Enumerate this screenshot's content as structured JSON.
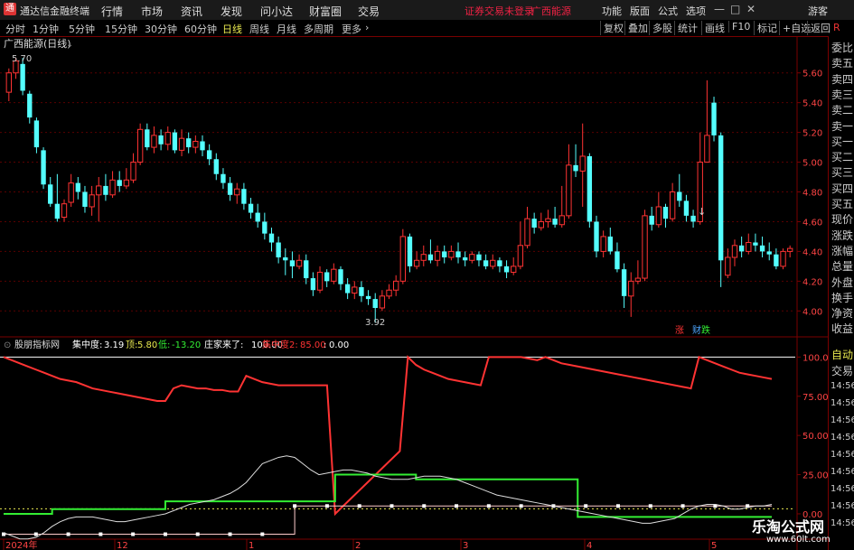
{
  "menubar": {
    "logo": "通",
    "app_title": "通达信金融终端",
    "items": [
      "行情",
      "市场",
      "资讯",
      "发现",
      "问小达",
      "财富圈",
      "交易"
    ],
    "notice": "证券交易未登录",
    "stock_name": "广西能源",
    "right_items": [
      "功能",
      "版面",
      "公式",
      "选项"
    ],
    "guest": "游客"
  },
  "toolbar": {
    "periods": [
      "分时",
      "1分钟",
      "5分钟",
      "15分钟",
      "30分钟",
      "60分钟",
      "日线",
      "周线",
      "月线",
      "多周期",
      "更多"
    ],
    "selected": "日线",
    "right_buttons": [
      "复权",
      "叠加",
      "多股",
      "统计",
      "画线",
      "F10",
      "标记",
      "+自选",
      "返回"
    ]
  },
  "main_chart": {
    "title": "广西能源(日线)",
    "high_label": "5.70",
    "low_label": "3.92",
    "zhang_label": "涨",
    "cai_label": "财",
    "die_label": "跌",
    "arrow_mark": "↓"
  },
  "indicator": {
    "name": "股朋指标网",
    "line1_label": "集中度:",
    "line1_value": "3.19",
    "line2_label": "顶:",
    "line2_value": "5.80",
    "line3_label": "低:",
    "line3_value": "-13.20",
    "line4_label": "庄家来了:",
    "line4_value": "100.00",
    "line5_label": "集中度2:",
    "line5_value": "85.00",
    "line6_label": ":",
    "line6_value": "0.00"
  },
  "right_panel": {
    "labels": [
      "委比",
      "卖五",
      "卖四",
      "卖三",
      "卖二",
      "卖一",
      "买一",
      "买二",
      "买三",
      "买四",
      "买五",
      "现价",
      "涨跌",
      "涨幅",
      "总量",
      "外盘",
      "换手",
      "净资",
      "收益"
    ],
    "bottom_labels": [
      "自动",
      "交易"
    ],
    "times": [
      "14:56",
      "14:56",
      "14:56",
      "14:56",
      "14:56",
      "14:56",
      "14:56",
      "14:56",
      "14:56"
    ]
  },
  "x_axis": {
    "labels": [
      "2024年",
      "12",
      "1",
      "2",
      "3",
      "4",
      "5"
    ]
  },
  "watermark": {
    "line1": "乐淘公式网",
    "line2": "www.60lt.com"
  },
  "chart_data": [
    {
      "type": "candlestick",
      "ylim": [
        3.85,
        5.75
      ],
      "yticks": [
        4.0,
        4.2,
        4.4,
        4.6,
        4.8,
        5.0,
        5.2,
        5.4,
        5.6
      ],
      "ytick_labels": [
        "4.00",
        "4.20",
        "4.40",
        "4.60",
        "4.80",
        "5.00",
        "5.20",
        "5.40",
        "5.60"
      ],
      "colors": {
        "up": "#ff3333",
        "down": "#54ffff"
      },
      "candles": [
        [
          5.47,
          5.6,
          5.63,
          5.41
        ],
        [
          5.6,
          5.68,
          5.7,
          5.56
        ],
        [
          5.66,
          5.48,
          5.7,
          5.45
        ],
        [
          5.46,
          5.3,
          5.48,
          5.26
        ],
        [
          5.28,
          5.1,
          5.3,
          5.06
        ],
        [
          5.08,
          4.85,
          5.1,
          4.82
        ],
        [
          4.85,
          4.72,
          4.9,
          4.7
        ],
        [
          4.72,
          4.62,
          4.92,
          4.6
        ],
        [
          4.63,
          4.72,
          4.75,
          4.6
        ],
        [
          4.73,
          4.86,
          4.92,
          4.7
        ],
        [
          4.86,
          4.8,
          4.9,
          4.75
        ],
        [
          4.8,
          4.7,
          4.84,
          4.66
        ],
        [
          4.7,
          4.78,
          4.84,
          4.64
        ],
        [
          4.78,
          4.84,
          4.9,
          4.6
        ],
        [
          4.84,
          4.78,
          4.92,
          4.74
        ],
        [
          4.78,
          4.88,
          4.94,
          4.76
        ],
        [
          4.88,
          4.84,
          4.94,
          4.8
        ],
        [
          4.84,
          4.88,
          4.96,
          4.82
        ],
        [
          4.88,
          5.0,
          5.06,
          4.86
        ],
        [
          5.0,
          5.22,
          5.26,
          4.98
        ],
        [
          5.22,
          5.1,
          5.26,
          5.08
        ],
        [
          5.1,
          5.18,
          5.24,
          5.06
        ],
        [
          5.18,
          5.12,
          5.22,
          5.08
        ],
        [
          5.12,
          5.2,
          5.24,
          5.08
        ],
        [
          5.2,
          5.08,
          5.22,
          5.06
        ],
        [
          5.08,
          5.16,
          5.22,
          5.04
        ],
        [
          5.16,
          5.1,
          5.2,
          5.06
        ],
        [
          5.1,
          5.14,
          5.18,
          5.06
        ],
        [
          5.14,
          5.08,
          5.18,
          5.04
        ],
        [
          5.08,
          5.02,
          5.12,
          4.98
        ],
        [
          5.02,
          4.92,
          5.06,
          4.88
        ],
        [
          4.92,
          4.86,
          4.96,
          4.82
        ],
        [
          4.86,
          4.78,
          4.9,
          4.74
        ],
        [
          4.78,
          4.82,
          4.86,
          4.72
        ],
        [
          4.82,
          4.72,
          4.86,
          4.68
        ],
        [
          4.72,
          4.66,
          4.76,
          4.62
        ],
        [
          4.66,
          4.6,
          4.72,
          4.56
        ],
        [
          4.6,
          4.52,
          4.66,
          4.48
        ],
        [
          4.52,
          4.46,
          4.56,
          4.4
        ],
        [
          4.46,
          4.36,
          4.5,
          4.32
        ],
        [
          4.36,
          4.34,
          4.42,
          4.24
        ],
        [
          4.34,
          4.3,
          4.4,
          4.22
        ],
        [
          4.3,
          4.34,
          4.38,
          4.28
        ],
        [
          4.34,
          4.22,
          4.38,
          4.18
        ],
        [
          4.22,
          4.14,
          4.26,
          4.1
        ],
        [
          4.14,
          4.26,
          4.3,
          4.12
        ],
        [
          4.26,
          4.2,
          4.28,
          4.16
        ],
        [
          4.2,
          4.28,
          4.32,
          4.18
        ],
        [
          4.28,
          4.18,
          4.3,
          4.14
        ],
        [
          4.18,
          4.12,
          4.22,
          4.08
        ],
        [
          4.12,
          4.16,
          4.2,
          4.08
        ],
        [
          4.16,
          4.1,
          4.2,
          4.06
        ],
        [
          4.1,
          4.08,
          4.14,
          4.04
        ],
        [
          4.08,
          4.02,
          4.12,
          3.92
        ],
        [
          4.02,
          4.1,
          4.14,
          4.0
        ],
        [
          4.1,
          4.14,
          4.18,
          4.08
        ],
        [
          4.14,
          4.2,
          4.24,
          4.1
        ],
        [
          4.2,
          4.5,
          4.55,
          4.18
        ],
        [
          4.5,
          4.3,
          4.52,
          4.26
        ],
        [
          4.3,
          4.34,
          4.4,
          4.28
        ],
        [
          4.34,
          4.38,
          4.44,
          4.3
        ],
        [
          4.38,
          4.34,
          4.48,
          4.32
        ],
        [
          4.34,
          4.4,
          4.44,
          4.3
        ],
        [
          4.4,
          4.36,
          4.44,
          4.32
        ],
        [
          4.36,
          4.4,
          4.44,
          4.34
        ],
        [
          4.4,
          4.36,
          4.46,
          4.32
        ],
        [
          4.36,
          4.34,
          4.4,
          4.3
        ],
        [
          4.34,
          4.38,
          4.4,
          4.32
        ],
        [
          4.38,
          4.34,
          4.4,
          4.3
        ],
        [
          4.34,
          4.3,
          4.38,
          4.28
        ],
        [
          4.3,
          4.34,
          4.38,
          4.28
        ],
        [
          4.34,
          4.3,
          4.36,
          4.26
        ],
        [
          4.3,
          4.26,
          4.34,
          4.22
        ],
        [
          4.26,
          4.3,
          4.36,
          4.24
        ],
        [
          4.3,
          4.44,
          4.6,
          4.28
        ],
        [
          4.44,
          4.62,
          4.7,
          4.42
        ],
        [
          4.62,
          4.56,
          4.66,
          4.52
        ],
        [
          4.56,
          4.6,
          4.66,
          4.54
        ],
        [
          4.6,
          4.62,
          4.68,
          4.56
        ],
        [
          4.62,
          4.58,
          4.7,
          4.56
        ],
        [
          4.58,
          4.64,
          4.84,
          4.56
        ],
        [
          4.64,
          4.98,
          5.12,
          4.62
        ],
        [
          4.98,
          4.94,
          5.12,
          4.9
        ],
        [
          4.94,
          5.04,
          5.26,
          4.7
        ],
        [
          5.04,
          4.6,
          5.06,
          4.56
        ],
        [
          4.6,
          4.4,
          4.64,
          4.36
        ],
        [
          4.4,
          4.5,
          4.54,
          4.36
        ],
        [
          4.5,
          4.4,
          4.56,
          4.38
        ],
        [
          4.4,
          4.28,
          4.46,
          4.26
        ],
        [
          4.28,
          4.1,
          4.32,
          4.02
        ],
        [
          4.1,
          4.2,
          4.26,
          3.96
        ],
        [
          4.2,
          4.22,
          4.34,
          4.18
        ],
        [
          4.22,
          4.64,
          4.68,
          4.2
        ],
        [
          4.64,
          4.58,
          4.7,
          4.54
        ],
        [
          4.58,
          4.7,
          4.8,
          4.56
        ],
        [
          4.7,
          4.62,
          4.72,
          4.56
        ],
        [
          4.62,
          4.8,
          4.86,
          4.6
        ],
        [
          4.8,
          4.74,
          4.92,
          4.7
        ],
        [
          4.74,
          4.64,
          4.78,
          4.6
        ],
        [
          4.64,
          4.6,
          4.68,
          4.56
        ],
        [
          4.6,
          5.0,
          5.2,
          4.58
        ],
        [
          5.0,
          5.18,
          5.55,
          5.0
        ],
        [
          5.4,
          5.18,
          5.44,
          5.14
        ],
        [
          5.18,
          4.34,
          5.2,
          4.16
        ],
        [
          4.24,
          4.36,
          4.42,
          4.22
        ],
        [
          4.36,
          4.44,
          4.48,
          4.3
        ],
        [
          4.44,
          4.4,
          4.5,
          4.36
        ],
        [
          4.4,
          4.46,
          4.52,
          4.38
        ],
        [
          4.46,
          4.44,
          4.52,
          4.4
        ],
        [
          4.44,
          4.4,
          4.5,
          4.36
        ],
        [
          4.4,
          4.38,
          4.46,
          4.34
        ],
        [
          4.38,
          4.3,
          4.42,
          4.28
        ],
        [
          4.3,
          4.4,
          4.42,
          4.28
        ],
        [
          4.4,
          4.42,
          4.44,
          4.36
        ]
      ],
      "candle_fields": [
        "open",
        "close",
        "high",
        "low"
      ]
    },
    {
      "type": "line",
      "ylim": [
        -15,
        110
      ],
      "yticks": [
        100,
        75,
        50,
        25,
        0
      ],
      "ytick_labels": [
        "100.0",
        "75.00",
        "50.00",
        "25.00",
        "0.00"
      ],
      "x_points": 96,
      "series": [
        {
          "color": "#ff3333",
          "values": [
            100,
            98,
            96,
            94,
            92,
            90,
            88,
            86,
            85,
            84,
            82,
            80,
            79,
            78,
            77,
            76,
            75,
            74,
            73,
            72,
            72,
            80,
            82,
            81,
            80,
            80,
            79,
            79,
            78,
            78,
            88,
            86,
            84,
            83,
            82,
            82,
            82,
            82,
            82,
            82,
            82,
            0,
            5,
            10,
            15,
            20,
            25,
            30,
            35,
            40,
            100,
            95,
            92,
            90,
            88,
            86,
            85,
            84,
            83,
            82,
            100,
            100,
            100,
            100,
            100,
            99,
            98,
            100,
            98,
            96,
            95,
            94,
            93,
            92,
            91,
            90,
            89,
            88,
            87,
            86,
            85,
            84,
            83,
            82,
            81,
            80,
            100,
            98,
            96,
            94,
            92,
            90,
            89,
            88,
            87,
            86
          ]
        },
        {
          "color": "#33ee33",
          "values": [
            0,
            0,
            0,
            0,
            0,
            0,
            3,
            3,
            3,
            3,
            3,
            3,
            3,
            3,
            3,
            3,
            3,
            3,
            3,
            3,
            8,
            8,
            8,
            8,
            8,
            8,
            8,
            8,
            8,
            8,
            8,
            8,
            8,
            8,
            8,
            8,
            8,
            8,
            8,
            8,
            8,
            25,
            25,
            25,
            25,
            25,
            25,
            25,
            25,
            25,
            25,
            22,
            22,
            22,
            22,
            22,
            22,
            22,
            22,
            22,
            22,
            22,
            22,
            22,
            22,
            22,
            22,
            22,
            22,
            22,
            22,
            -2,
            -2,
            -2,
            -2,
            -2,
            -2,
            -2,
            -2,
            -2,
            -2,
            -2,
            -2,
            -2,
            -2,
            -2,
            -2,
            -2,
            -2,
            -2,
            -2,
            -2,
            -2,
            -2,
            -2,
            -2
          ]
        },
        {
          "color": "#ffcccc",
          "values": [
            -13,
            -13,
            -13,
            -13,
            -13,
            -13,
            -13,
            -13,
            -13,
            -13,
            -13,
            -13,
            -13,
            -13,
            -13,
            -13,
            -13,
            -13,
            -13,
            -13,
            -13,
            -13,
            -13,
            -13,
            -13,
            -13,
            -13,
            -13,
            -13,
            -13,
            -13,
            -13,
            -13,
            -13,
            -13,
            -13,
            5,
            5,
            5,
            5,
            5,
            5,
            5,
            5,
            5,
            5,
            5,
            5,
            5,
            5,
            5,
            5,
            5,
            5,
            5,
            5,
            5,
            5,
            5,
            5,
            5,
            5,
            5,
            5,
            5,
            5,
            5,
            5,
            5,
            5,
            5,
            5,
            5,
            5,
            5,
            5,
            5,
            5,
            5,
            5,
            5,
            5,
            5,
            5,
            5,
            5,
            5,
            5,
            5,
            5,
            5,
            5,
            5,
            5,
            5,
            5
          ]
        },
        {
          "color": "#dddddd",
          "values": [
            -12,
            -14,
            -16,
            -16,
            -15,
            -12,
            -8,
            -5,
            -3,
            -2,
            -2,
            -2,
            -3,
            -4,
            -5,
            -5,
            -4,
            -3,
            -2,
            -1,
            0,
            2,
            4,
            6,
            7,
            8,
            9,
            11,
            13,
            16,
            20,
            26,
            32,
            34,
            36,
            37,
            36,
            32,
            28,
            25,
            26,
            27,
            28,
            28,
            27,
            26,
            24,
            23,
            22,
            22,
            22,
            23,
            24,
            24,
            24,
            23,
            22,
            20,
            18,
            16,
            14,
            12,
            11,
            10,
            9,
            8,
            7,
            6,
            5,
            4,
            3,
            2,
            1,
            0,
            -1,
            -2,
            -3,
            -4,
            -5,
            -6,
            -6,
            -5,
            -4,
            -3,
            0,
            3,
            5,
            6,
            6,
            5,
            3,
            3,
            4,
            5,
            5,
            6
          ]
        }
      ],
      "dotted_level": 3.19
    }
  ]
}
